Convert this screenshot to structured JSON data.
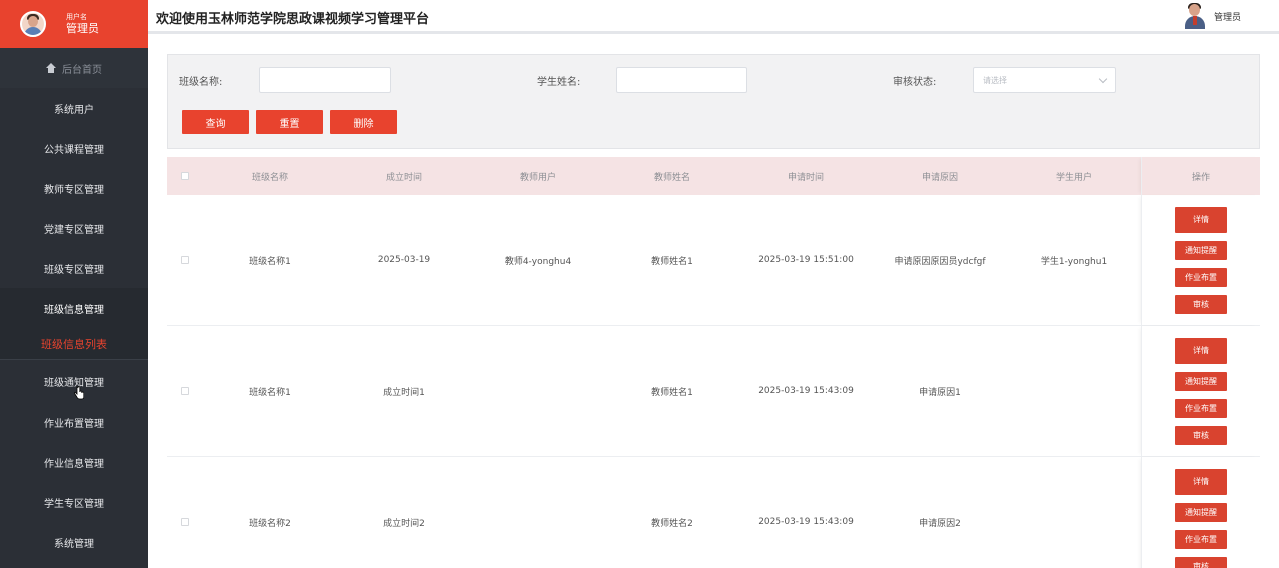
{
  "sidebar": {
    "user_sub": "用户名",
    "user_name": "管理员",
    "home": "后台首页",
    "items": [
      {
        "label": "系统用户"
      },
      {
        "label": "公共课程管理"
      },
      {
        "label": "教师专区管理"
      },
      {
        "label": "党建专区管理"
      },
      {
        "label": "班级专区管理"
      },
      {
        "label": "班级信息管理"
      }
    ],
    "active_sub": "班级信息列表",
    "items_after": [
      {
        "label": "班级通知管理"
      },
      {
        "label": "作业布置管理"
      },
      {
        "label": "作业信息管理"
      },
      {
        "label": "学生专区管理"
      },
      {
        "label": "系统管理"
      }
    ]
  },
  "header": {
    "title": "欢迎使用玉林师范学院思政课视频学习管理平台",
    "user": "管理员"
  },
  "search": {
    "class_name_label": "班级名称:",
    "class_name_value": "",
    "student_name_label": "学生姓名:",
    "student_name_value": "",
    "status_label": "审核状态:",
    "status_placeholder": "请选择",
    "query": "查询",
    "reset": "重置",
    "delete": "删除"
  },
  "table": {
    "headers": [
      "班级名称",
      "成立时间",
      "教师用户",
      "教师姓名",
      "申请时间",
      "申请原因",
      "学生用户",
      "操作"
    ],
    "rows": [
      [
        "班级名称1",
        "2025-03-19",
        "教师4-yonghu4",
        "教师姓名1",
        "2025-03-19 15:51:00",
        "申请原因原因员ydcfgf",
        "学生1-yonghu1"
      ],
      [
        "班级名称1",
        "成立时间1",
        "",
        "教师姓名1",
        "2025-03-19 15:43:09",
        "申请原因1",
        ""
      ],
      [
        "班级名称2",
        "成立时间2",
        "",
        "教师姓名2",
        "2025-03-19 15:43:09",
        "申请原因2",
        ""
      ]
    ],
    "actions": [
      "详情",
      "通知提醒",
      "作业布置",
      "审核"
    ]
  },
  "colors": {
    "accent": "#e8432e",
    "sidebar_bg": "#2b2f36",
    "table_header_bg": "#f5e3e4"
  }
}
